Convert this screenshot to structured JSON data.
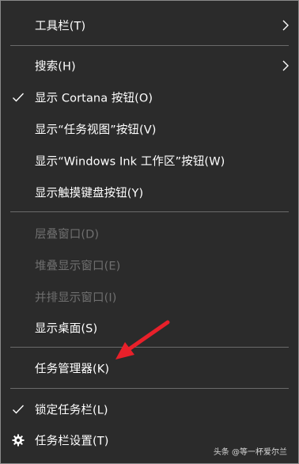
{
  "menu": {
    "items": [
      {
        "label": "工具栏(T)"
      },
      {
        "label": "搜索(H)"
      },
      {
        "label": "显示 Cortana 按钮(O)"
      },
      {
        "label": "显示“任务视图”按钮(V)"
      },
      {
        "label": "显示“Windows Ink 工作区”按钮(W)"
      },
      {
        "label": "显示触摸键盘按钮(Y)"
      },
      {
        "label": "层叠窗口(D)"
      },
      {
        "label": "堆叠显示窗口(E)"
      },
      {
        "label": "并排显示窗口(I)"
      },
      {
        "label": "显示桌面(S)"
      },
      {
        "label": "任务管理器(K)"
      },
      {
        "label": "锁定任务栏(L)"
      },
      {
        "label": "任务栏设置(T)"
      }
    ]
  },
  "watermark": "头条 @等一杯爱尔兰",
  "colors": {
    "background": "#2b2b2b",
    "text": "#ffffff",
    "disabled_text": "#6f6f6f",
    "separator": "#6a6a6a",
    "annotation_arrow": "#e8202a"
  }
}
